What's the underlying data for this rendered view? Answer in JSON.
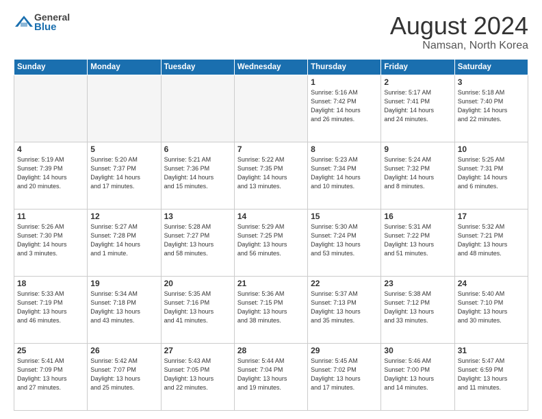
{
  "header": {
    "logo_general": "General",
    "logo_blue": "Blue",
    "month": "August 2024",
    "location": "Namsan, North Korea"
  },
  "days_of_week": [
    "Sunday",
    "Monday",
    "Tuesday",
    "Wednesday",
    "Thursday",
    "Friday",
    "Saturday"
  ],
  "weeks": [
    [
      {
        "num": "",
        "info": "",
        "empty": true
      },
      {
        "num": "",
        "info": "",
        "empty": true
      },
      {
        "num": "",
        "info": "",
        "empty": true
      },
      {
        "num": "",
        "info": "",
        "empty": true
      },
      {
        "num": "1",
        "info": "Sunrise: 5:16 AM\nSunset: 7:42 PM\nDaylight: 14 hours\nand 26 minutes.",
        "empty": false
      },
      {
        "num": "2",
        "info": "Sunrise: 5:17 AM\nSunset: 7:41 PM\nDaylight: 14 hours\nand 24 minutes.",
        "empty": false
      },
      {
        "num": "3",
        "info": "Sunrise: 5:18 AM\nSunset: 7:40 PM\nDaylight: 14 hours\nand 22 minutes.",
        "empty": false
      }
    ],
    [
      {
        "num": "4",
        "info": "Sunrise: 5:19 AM\nSunset: 7:39 PM\nDaylight: 14 hours\nand 20 minutes.",
        "empty": false
      },
      {
        "num": "5",
        "info": "Sunrise: 5:20 AM\nSunset: 7:37 PM\nDaylight: 14 hours\nand 17 minutes.",
        "empty": false
      },
      {
        "num": "6",
        "info": "Sunrise: 5:21 AM\nSunset: 7:36 PM\nDaylight: 14 hours\nand 15 minutes.",
        "empty": false
      },
      {
        "num": "7",
        "info": "Sunrise: 5:22 AM\nSunset: 7:35 PM\nDaylight: 14 hours\nand 13 minutes.",
        "empty": false
      },
      {
        "num": "8",
        "info": "Sunrise: 5:23 AM\nSunset: 7:34 PM\nDaylight: 14 hours\nand 10 minutes.",
        "empty": false
      },
      {
        "num": "9",
        "info": "Sunrise: 5:24 AM\nSunset: 7:32 PM\nDaylight: 14 hours\nand 8 minutes.",
        "empty": false
      },
      {
        "num": "10",
        "info": "Sunrise: 5:25 AM\nSunset: 7:31 PM\nDaylight: 14 hours\nand 6 minutes.",
        "empty": false
      }
    ],
    [
      {
        "num": "11",
        "info": "Sunrise: 5:26 AM\nSunset: 7:30 PM\nDaylight: 14 hours\nand 3 minutes.",
        "empty": false
      },
      {
        "num": "12",
        "info": "Sunrise: 5:27 AM\nSunset: 7:28 PM\nDaylight: 14 hours\nand 1 minute.",
        "empty": false
      },
      {
        "num": "13",
        "info": "Sunrise: 5:28 AM\nSunset: 7:27 PM\nDaylight: 13 hours\nand 58 minutes.",
        "empty": false
      },
      {
        "num": "14",
        "info": "Sunrise: 5:29 AM\nSunset: 7:25 PM\nDaylight: 13 hours\nand 56 minutes.",
        "empty": false
      },
      {
        "num": "15",
        "info": "Sunrise: 5:30 AM\nSunset: 7:24 PM\nDaylight: 13 hours\nand 53 minutes.",
        "empty": false
      },
      {
        "num": "16",
        "info": "Sunrise: 5:31 AM\nSunset: 7:22 PM\nDaylight: 13 hours\nand 51 minutes.",
        "empty": false
      },
      {
        "num": "17",
        "info": "Sunrise: 5:32 AM\nSunset: 7:21 PM\nDaylight: 13 hours\nand 48 minutes.",
        "empty": false
      }
    ],
    [
      {
        "num": "18",
        "info": "Sunrise: 5:33 AM\nSunset: 7:19 PM\nDaylight: 13 hours\nand 46 minutes.",
        "empty": false
      },
      {
        "num": "19",
        "info": "Sunrise: 5:34 AM\nSunset: 7:18 PM\nDaylight: 13 hours\nand 43 minutes.",
        "empty": false
      },
      {
        "num": "20",
        "info": "Sunrise: 5:35 AM\nSunset: 7:16 PM\nDaylight: 13 hours\nand 41 minutes.",
        "empty": false
      },
      {
        "num": "21",
        "info": "Sunrise: 5:36 AM\nSunset: 7:15 PM\nDaylight: 13 hours\nand 38 minutes.",
        "empty": false
      },
      {
        "num": "22",
        "info": "Sunrise: 5:37 AM\nSunset: 7:13 PM\nDaylight: 13 hours\nand 35 minutes.",
        "empty": false
      },
      {
        "num": "23",
        "info": "Sunrise: 5:38 AM\nSunset: 7:12 PM\nDaylight: 13 hours\nand 33 minutes.",
        "empty": false
      },
      {
        "num": "24",
        "info": "Sunrise: 5:40 AM\nSunset: 7:10 PM\nDaylight: 13 hours\nand 30 minutes.",
        "empty": false
      }
    ],
    [
      {
        "num": "25",
        "info": "Sunrise: 5:41 AM\nSunset: 7:09 PM\nDaylight: 13 hours\nand 27 minutes.",
        "empty": false
      },
      {
        "num": "26",
        "info": "Sunrise: 5:42 AM\nSunset: 7:07 PM\nDaylight: 13 hours\nand 25 minutes.",
        "empty": false
      },
      {
        "num": "27",
        "info": "Sunrise: 5:43 AM\nSunset: 7:05 PM\nDaylight: 13 hours\nand 22 minutes.",
        "empty": false
      },
      {
        "num": "28",
        "info": "Sunrise: 5:44 AM\nSunset: 7:04 PM\nDaylight: 13 hours\nand 19 minutes.",
        "empty": false
      },
      {
        "num": "29",
        "info": "Sunrise: 5:45 AM\nSunset: 7:02 PM\nDaylight: 13 hours\nand 17 minutes.",
        "empty": false
      },
      {
        "num": "30",
        "info": "Sunrise: 5:46 AM\nSunset: 7:00 PM\nDaylight: 13 hours\nand 14 minutes.",
        "empty": false
      },
      {
        "num": "31",
        "info": "Sunrise: 5:47 AM\nSunset: 6:59 PM\nDaylight: 13 hours\nand 11 minutes.",
        "empty": false
      }
    ]
  ]
}
